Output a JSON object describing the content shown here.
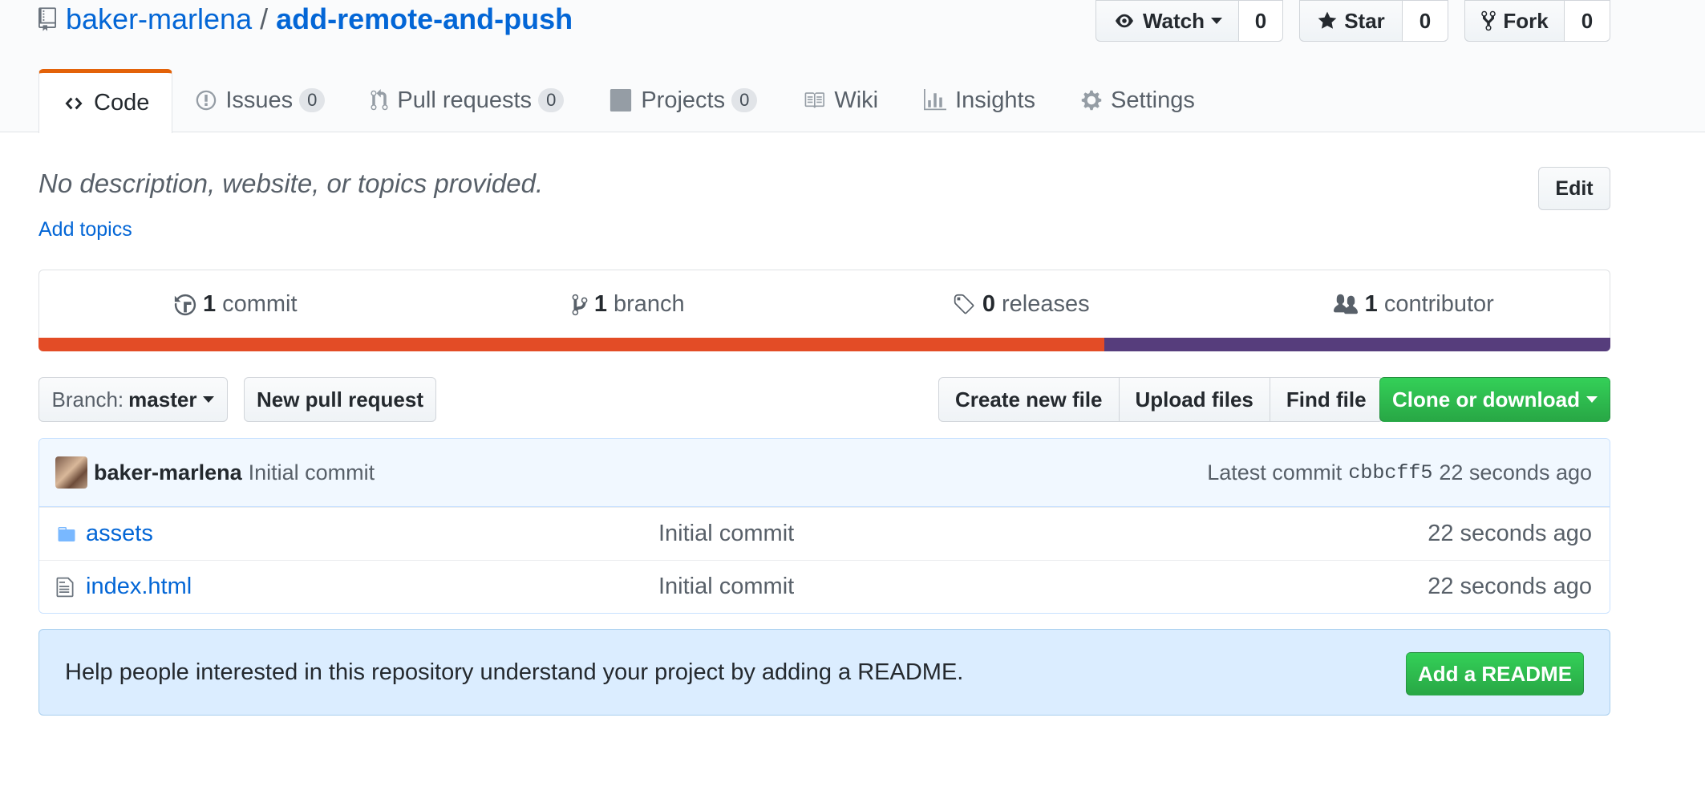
{
  "repo": {
    "owner": "baker-marlena",
    "separator": "/",
    "name": "add-remote-and-push"
  },
  "actions": {
    "watch_label": "Watch",
    "watch_count": "0",
    "star_label": "Star",
    "star_count": "0",
    "fork_label": "Fork",
    "fork_count": "0"
  },
  "tabs": [
    {
      "label": "Code",
      "icon": "code-icon",
      "selected": true
    },
    {
      "label": "Issues",
      "icon": "issue-icon",
      "count": "0"
    },
    {
      "label": "Pull requests",
      "icon": "pull-request-icon",
      "count": "0"
    },
    {
      "label": "Projects",
      "icon": "project-icon",
      "count": "0"
    },
    {
      "label": "Wiki",
      "icon": "book-icon"
    },
    {
      "label": "Insights",
      "icon": "graph-icon"
    },
    {
      "label": "Settings",
      "icon": "gear-icon"
    }
  ],
  "description": {
    "text": "No description, website, or topics provided.",
    "add_topics": "Add topics",
    "edit_label": "Edit"
  },
  "numbers": [
    {
      "value": "1",
      "label": "commit",
      "icon": "history-icon"
    },
    {
      "value": "1",
      "label": "branch",
      "icon": "branch-icon"
    },
    {
      "value": "0",
      "label": "releases",
      "icon": "tag-icon"
    },
    {
      "value": "1",
      "label": "contributor",
      "icon": "people-icon"
    }
  ],
  "languages": [
    {
      "color": "#e34c26",
      "share": 0.678
    },
    {
      "color": "#563d7c",
      "share": 0.322
    }
  ],
  "file_nav": {
    "branch_label": "Branch:",
    "branch_value": "master",
    "new_pr": "New pull request",
    "create_file": "Create new file",
    "upload_files": "Upload files",
    "find_file": "Find file",
    "clone": "Clone or download"
  },
  "commit": {
    "author": "baker-marlena",
    "message": "Initial commit",
    "latest_label": "Latest commit",
    "sha": "cbbcff5",
    "age": "22 seconds ago"
  },
  "files": [
    {
      "name": "assets",
      "type": "folder",
      "message": "Initial commit",
      "age": "22 seconds ago"
    },
    {
      "name": "index.html",
      "type": "file",
      "message": "Initial commit",
      "age": "22 seconds ago"
    }
  ],
  "readme": {
    "text": "Help people interested in this repository understand your project by adding a README.",
    "button": "Add a README"
  }
}
